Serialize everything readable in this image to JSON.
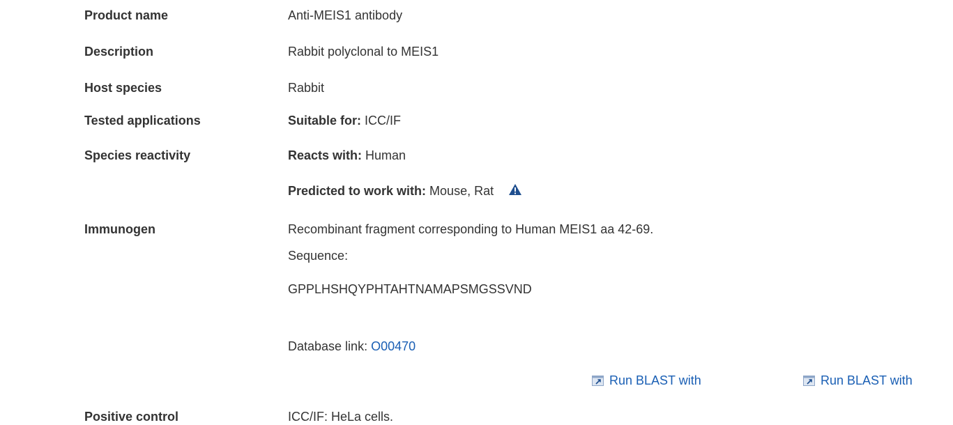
{
  "rows": {
    "product_name": {
      "label": "Product name",
      "value": "Anti-MEIS1 antibody"
    },
    "description": {
      "label": "Description",
      "value": "Rabbit polyclonal to MEIS1"
    },
    "host_species": {
      "label": "Host species",
      "value": "Rabbit"
    },
    "tested_applications": {
      "label": "Tested applications",
      "prefix": "Suitable for:",
      "value": "ICC/IF"
    },
    "species_reactivity": {
      "label": "Species reactivity",
      "reacts_prefix": "Reacts with:",
      "reacts_value": "Human",
      "predicted_prefix": "Predicted to work with:",
      "predicted_value": "Mouse, Rat",
      "warning_icon": "warning-triangle-icon"
    },
    "immunogen": {
      "label": "Immunogen",
      "line1": "Recombinant fragment corresponding to Human MEIS1 aa 42-69.",
      "line2": "Sequence:",
      "sequence": "GPPLHSHQYPHTAHTNAMAPSMGSSVND",
      "db_prefix": "Database link:",
      "db_link": "O00470"
    },
    "positive_control": {
      "label": "Positive control",
      "value": "ICC/IF: HeLa cells."
    }
  },
  "blast_links": [
    {
      "label": "Run BLAST with",
      "icon": "external-link-icon"
    },
    {
      "label": "Run BLAST with",
      "icon": "external-link-icon"
    }
  ],
  "colors": {
    "text": "#333333",
    "link": "#1a5fb4",
    "icon": "#1f4f8f"
  }
}
